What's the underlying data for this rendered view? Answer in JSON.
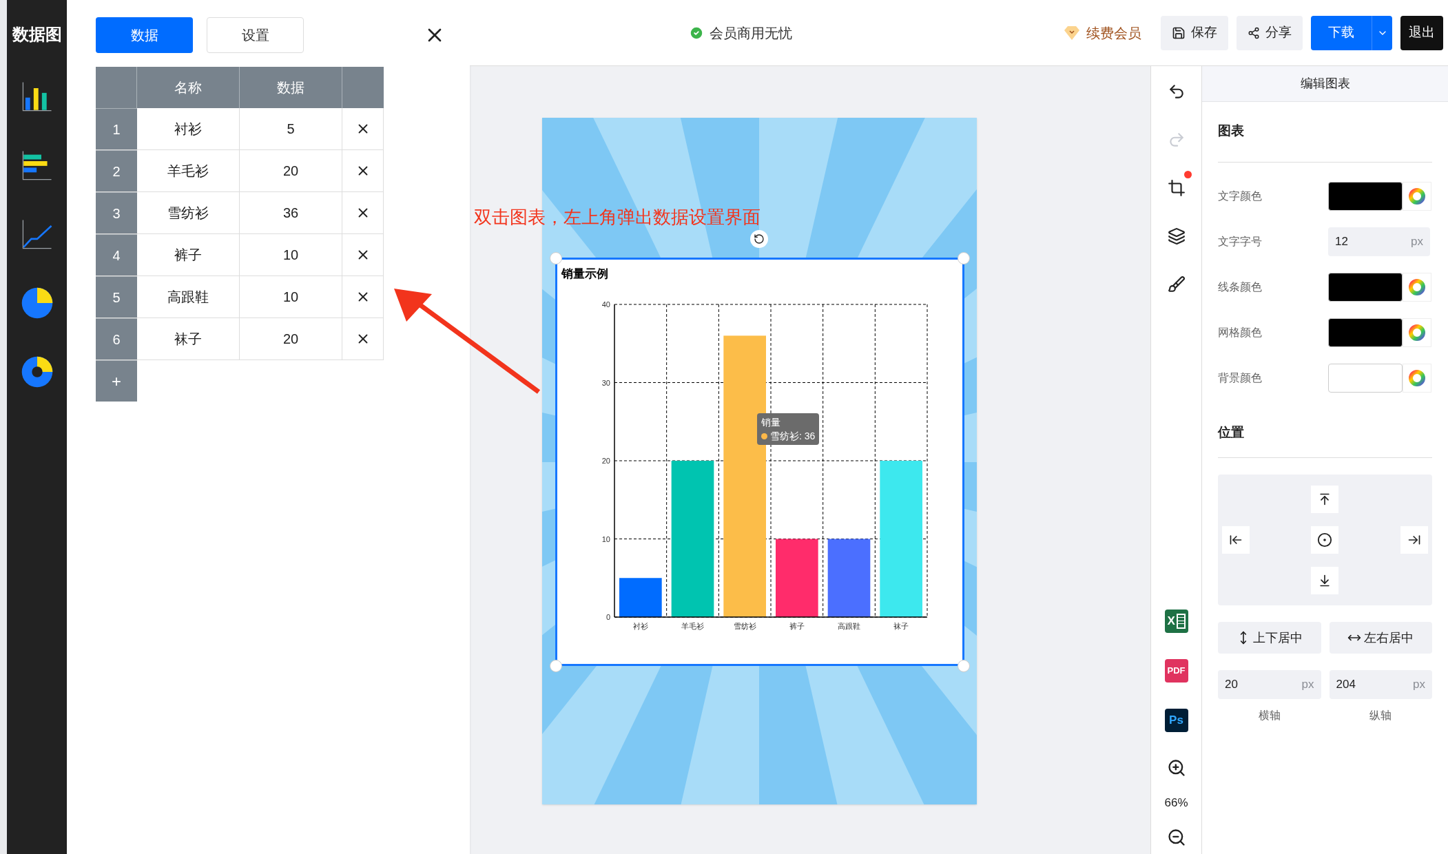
{
  "sidebar": {
    "title": "数据图",
    "chart_types": [
      {
        "kind": "bar",
        "selected": false
      },
      {
        "kind": "hbar",
        "selected": false
      },
      {
        "kind": "line",
        "selected": false
      },
      {
        "kind": "pie",
        "selected": false
      },
      {
        "kind": "donut",
        "selected": false
      }
    ]
  },
  "data_panel": {
    "tabs": [
      {
        "label": "数据",
        "selected": true
      },
      {
        "label": "设置",
        "selected": false
      }
    ],
    "table": {
      "columns": [
        "名称",
        "数据"
      ],
      "rows": [
        {
          "index": "1",
          "name": "衬衫",
          "value": "5"
        },
        {
          "index": "2",
          "name": "羊毛衫",
          "value": "20"
        },
        {
          "index": "3",
          "name": "雪纺衫",
          "value": "36"
        },
        {
          "index": "4",
          "name": "裤子",
          "value": "10"
        },
        {
          "index": "5",
          "name": "高跟鞋",
          "value": "10"
        },
        {
          "index": "6",
          "name": "袜子",
          "value": "20"
        }
      ],
      "add_label": "+"
    }
  },
  "topbar": {
    "status": "会员商用无忧",
    "vip": "续费会员",
    "buttons": [
      {
        "kind": "save",
        "label": "保存"
      },
      {
        "kind": "share",
        "label": "分享"
      },
      {
        "kind": "download",
        "label": "下载"
      },
      {
        "kind": "exit",
        "label": "退出"
      }
    ]
  },
  "annotation": "双击图表，左上角弹出数据设置界面",
  "chart": {
    "tooltip": {
      "label": "雪纺衫: 36",
      "color": "#fcb849"
    },
    "chart_data": {
      "type": "bar",
      "title": "销量示例",
      "categories": [
        "衬衫",
        "羊毛衫",
        "雪纺衫",
        "裤子",
        "高跟鞋",
        "袜子"
      ],
      "series": [
        {
          "name": "销量",
          "colors": [
            "#006cff",
            "#00c4b0",
            "#fcbd49",
            "#ff2c6b",
            "#4b6fff",
            "#3de8ee"
          ],
          "values": [
            5,
            20,
            36,
            10,
            10,
            20
          ]
        }
      ],
      "ylim": [
        0,
        40
      ],
      "yticks": [
        0,
        10,
        20,
        30,
        40
      ],
      "grid": true
    }
  },
  "tools": [
    {
      "kind": "undo",
      "disabled": false
    },
    {
      "kind": "redo",
      "disabled": true
    },
    {
      "kind": "crop",
      "disabled": false,
      "badge": true
    },
    {
      "kind": "layers",
      "disabled": false
    },
    {
      "kind": "brush",
      "disabled": false
    }
  ],
  "exports": [
    {
      "kind": "excel",
      "label": "X"
    },
    {
      "kind": "pdf",
      "label": "PDF"
    },
    {
      "kind": "ps",
      "label": "Ps"
    }
  ],
  "zoom": "66%",
  "edit_panel": {
    "title": "编辑图表",
    "chart_section": "图表",
    "rows": [
      {
        "kind": "color",
        "label": "文字颜色",
        "color": "#000000"
      },
      {
        "kind": "number",
        "label": "文字字号",
        "value": "12",
        "unit": "px"
      },
      {
        "kind": "color",
        "label": "线条颜色",
        "color": "#000000"
      },
      {
        "kind": "color",
        "label": "网格颜色",
        "color": "#000000"
      },
      {
        "kind": "color",
        "label": "背景颜色",
        "color": "#ffffff"
      }
    ],
    "position_section": "位置",
    "center_buttons": [
      {
        "kind": "vertical",
        "label": "上下居中"
      },
      {
        "kind": "horizontal",
        "label": "左右居中"
      }
    ],
    "coords": [
      {
        "value": "20",
        "unit": "px",
        "label": "横轴"
      },
      {
        "value": "204",
        "unit": "px",
        "label": "纵轴"
      }
    ]
  }
}
